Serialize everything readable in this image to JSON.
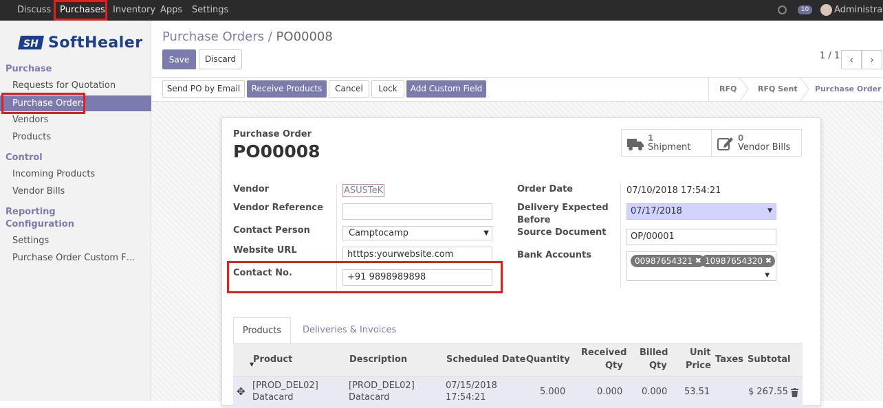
{
  "topbar": {
    "menus": [
      "Discuss",
      "Purchases",
      "Inventory",
      "Apps",
      "Settings"
    ],
    "badge": "10",
    "user": "Administrator"
  },
  "logo": {
    "text": "SoftHealer",
    "mark": "SH"
  },
  "sidebar": {
    "purchase_section": "Purchase",
    "purchase_items": [
      "Requests for Quotation",
      "Purchase Orders",
      "Vendors",
      "Products"
    ],
    "control_section": "Control",
    "control_items": [
      "Incoming Products",
      "Vendor Bills"
    ],
    "reporting_section": "Reporting",
    "configuration_section": "Configuration",
    "configuration_items": [
      "Settings",
      "Purchase Order Custom F…"
    ]
  },
  "breadcrumb": {
    "parent": "Purchase Orders",
    "sep": "/",
    "current": "PO00008"
  },
  "actions": {
    "save": "Save",
    "discard": "Discard"
  },
  "pager": {
    "text": "1 / 1",
    "prev": "‹",
    "next": "›"
  },
  "header_buttons": [
    "Send PO by Email",
    "Receive Products",
    "Cancel",
    "Lock",
    "Add Custom Field"
  ],
  "stages": [
    "RFQ",
    "RFQ Sent",
    "Purchase Order"
  ],
  "form": {
    "doc_type": "Purchase Order",
    "number": "PO00008",
    "smart_buttons": [
      {
        "count": "1",
        "label": "Shipment",
        "icon": "truck-icon"
      },
      {
        "count": "0",
        "label": "Vendor Bills",
        "icon": "edit-icon"
      }
    ],
    "left_fields": {
      "vendor_label": "Vendor",
      "vendor_value": "ASUSTeK",
      "vendor_ref_label": "Vendor Reference",
      "vendor_ref_value": "",
      "contact_person_label": "Contact Person",
      "contact_person_value": "Camptocamp",
      "website_label": "Website URL",
      "website_value": "htttps:yourwebsite.com",
      "contact_no_label": "Contact No.",
      "contact_no_value": "+91 9898989898"
    },
    "right_fields": {
      "order_date_label": "Order Date",
      "order_date_value": "07/10/2018 17:54:21",
      "delivery_label_1": "Delivery Expected",
      "delivery_label_2": "Before",
      "delivery_value": "07/17/2018",
      "source_doc_label": "Source Document",
      "source_doc_value": "OP/00001",
      "bank_label": "Bank Accounts",
      "bank_tags": [
        "00987654321",
        "10987654320"
      ]
    },
    "tabs": [
      "Products",
      "Deliveries & Invoices"
    ],
    "table": {
      "headers": {
        "product": "Product",
        "description": "Description",
        "scheduled_date": "Scheduled Date",
        "quantity": "Quantity",
        "received_1": "Received",
        "received_2": "Qty",
        "billed_1": "Billed",
        "billed_2": "Qty",
        "unit_1": "Unit",
        "unit_2": "Price",
        "taxes": "Taxes",
        "subtotal": "Subtotal"
      },
      "row": {
        "product_1": "[PROD_DEL02]",
        "product_2": "Datacard",
        "description_1": "[PROD_DEL02]",
        "description_2": "Datacard",
        "date_1": "07/15/2018",
        "date_2": "17:54:21",
        "quantity": "5.000",
        "received": "0.000",
        "billed": "0.000",
        "unit_price": "53.51",
        "taxes": "",
        "subtotal": "$ 267.55"
      }
    }
  },
  "colors": {
    "accent": "#7c7bad",
    "highlight": "#e0201a",
    "topbar": "#2b2b2b"
  }
}
